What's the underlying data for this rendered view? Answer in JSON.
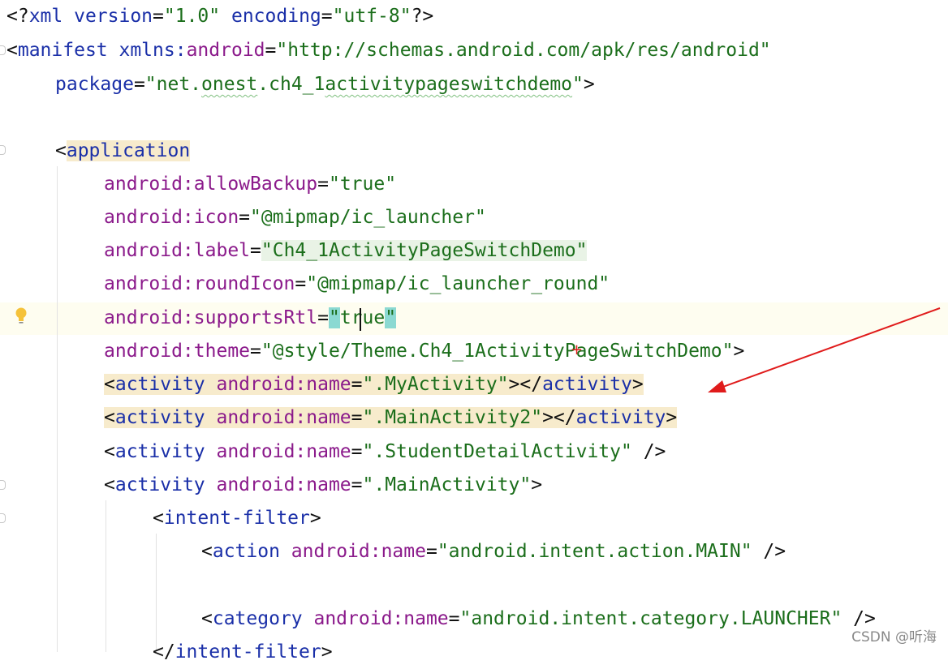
{
  "editor": {
    "lines": [
      [
        {
          "t": "<?",
          "c": "t-punct"
        },
        {
          "t": "xml",
          "c": "t-tag"
        },
        {
          "t": " version",
          "c": "t-hdrattr"
        },
        {
          "t": "=",
          "c": "t-punct"
        },
        {
          "t": "\"1.0\"",
          "c": "t-val"
        },
        {
          "t": " encoding",
          "c": "t-hdrattr"
        },
        {
          "t": "=",
          "c": "t-punct"
        },
        {
          "t": "\"utf-8\"",
          "c": "t-val"
        },
        {
          "t": "?>",
          "c": "t-punct"
        }
      ],
      [
        {
          "t": "<",
          "c": "t-punct"
        },
        {
          "t": "manifest",
          "c": "t-tag"
        },
        {
          "t": " xmlns:",
          "c": "t-hdrattr"
        },
        {
          "t": "android",
          "c": "t-ns"
        },
        {
          "t": "=",
          "c": "t-punct"
        },
        {
          "t": "\"http://schemas.android.com/apk/res/android\"",
          "c": "t-val"
        }
      ],
      [
        {
          "t": "package",
          "c": "t-hdrattr"
        },
        {
          "t": "=",
          "c": "t-punct"
        },
        {
          "t": "\"net.",
          "c": "t-val"
        },
        {
          "t": "onest",
          "c": "t-val squiggle"
        },
        {
          "t": ".ch4_1",
          "c": "t-val"
        },
        {
          "t": "activitypageswitchdemo",
          "c": "t-val squiggle"
        },
        {
          "t": "\"",
          "c": "t-val"
        },
        {
          "t": ">",
          "c": "t-punct"
        }
      ],
      [],
      [
        {
          "t": "<",
          "c": "t-punct"
        },
        {
          "t": "application",
          "c": "t-tag hl-tag"
        }
      ],
      [
        {
          "t": "android:",
          "c": "t-ns"
        },
        {
          "t": "allowBackup",
          "c": "t-attr"
        },
        {
          "t": "=",
          "c": "t-punct"
        },
        {
          "t": "\"true\"",
          "c": "t-val"
        }
      ],
      [
        {
          "t": "android:",
          "c": "t-ns"
        },
        {
          "t": "icon",
          "c": "t-attr"
        },
        {
          "t": "=",
          "c": "t-punct"
        },
        {
          "t": "\"@mipmap/ic_launcher\"",
          "c": "t-val"
        }
      ],
      [
        {
          "t": "android:",
          "c": "t-ns"
        },
        {
          "t": "label",
          "c": "t-attr"
        },
        {
          "t": "=",
          "c": "t-punct"
        },
        {
          "t": "\"Ch4_1ActivityPageSwitchDemo\"",
          "c": "t-val hl-val"
        }
      ],
      [
        {
          "t": "android:",
          "c": "t-ns"
        },
        {
          "t": "roundIcon",
          "c": "t-attr"
        },
        {
          "t": "=",
          "c": "t-punct"
        },
        {
          "t": "\"@mipmap/ic_launcher_round\"",
          "c": "t-val"
        }
      ],
      [
        {
          "t": "android:",
          "c": "t-ns"
        },
        {
          "t": "supportsRtl",
          "c": "t-attr"
        },
        {
          "t": "=",
          "c": "t-punct"
        },
        {
          "t": "\"",
          "c": "t-val hl-quote"
        },
        {
          "t": "true",
          "c": "t-val"
        },
        {
          "t": "\"",
          "c": "t-val hl-quote"
        }
      ],
      [
        {
          "t": "android:",
          "c": "t-ns"
        },
        {
          "t": "theme",
          "c": "t-attr"
        },
        {
          "t": "=",
          "c": "t-punct"
        },
        {
          "t": "\"@style/Theme.Ch4_1ActivityPageSwitchDemo\"",
          "c": "t-val"
        },
        {
          "t": ">",
          "c": "t-punct"
        }
      ],
      [
        {
          "t": "<",
          "c": "t-punct hl-tag"
        },
        {
          "t": "activity",
          "c": "t-tag hl-tag"
        },
        {
          "t": " android:",
          "c": "t-ns hl-tag"
        },
        {
          "t": "name",
          "c": "t-attr hl-tag"
        },
        {
          "t": "=",
          "c": "t-punct hl-tag"
        },
        {
          "t": "\".MyActivity\"",
          "c": "t-val hl-tag"
        },
        {
          "t": "></",
          "c": "t-punct hl-tag"
        },
        {
          "t": "activity",
          "c": "t-tag hl-tag"
        },
        {
          "t": ">",
          "c": "t-punct hl-tag"
        }
      ],
      [
        {
          "t": "<",
          "c": "t-punct hl-tag"
        },
        {
          "t": "activity",
          "c": "t-tag hl-tag"
        },
        {
          "t": " android:",
          "c": "t-ns hl-tag"
        },
        {
          "t": "name",
          "c": "t-attr hl-tag"
        },
        {
          "t": "=",
          "c": "t-punct hl-tag"
        },
        {
          "t": "\".MainActivity2\"",
          "c": "t-val hl-tag"
        },
        {
          "t": "></",
          "c": "t-punct hl-tag"
        },
        {
          "t": "activity",
          "c": "t-tag hl-tag"
        },
        {
          "t": ">",
          "c": "t-punct hl-tag"
        }
      ],
      [
        {
          "t": "<",
          "c": "t-punct"
        },
        {
          "t": "activity",
          "c": "t-tag"
        },
        {
          "t": " android:",
          "c": "t-ns"
        },
        {
          "t": "name",
          "c": "t-attr"
        },
        {
          "t": "=",
          "c": "t-punct"
        },
        {
          "t": "\".StudentDetailActivity\"",
          "c": "t-val"
        },
        {
          "t": " />",
          "c": "t-punct"
        }
      ],
      [
        {
          "t": "<",
          "c": "t-punct"
        },
        {
          "t": "activity",
          "c": "t-tag"
        },
        {
          "t": " android:",
          "c": "t-ns"
        },
        {
          "t": "name",
          "c": "t-attr"
        },
        {
          "t": "=",
          "c": "t-punct"
        },
        {
          "t": "\".MainActivity\"",
          "c": "t-val"
        },
        {
          "t": ">",
          "c": "t-punct"
        }
      ],
      [
        {
          "t": "<",
          "c": "t-punct"
        },
        {
          "t": "intent-filter",
          "c": "t-tag"
        },
        {
          "t": ">",
          "c": "t-punct"
        }
      ],
      [
        {
          "t": "<",
          "c": "t-punct"
        },
        {
          "t": "action",
          "c": "t-tag"
        },
        {
          "t": " android:",
          "c": "t-ns"
        },
        {
          "t": "name",
          "c": "t-attr"
        },
        {
          "t": "=",
          "c": "t-punct"
        },
        {
          "t": "\"android.intent.action.MAIN\"",
          "c": "t-val"
        },
        {
          "t": " />",
          "c": "t-punct"
        }
      ],
      [],
      [
        {
          "t": "<",
          "c": "t-punct"
        },
        {
          "t": "category",
          "c": "t-tag"
        },
        {
          "t": " android:",
          "c": "t-ns"
        },
        {
          "t": "name",
          "c": "t-attr"
        },
        {
          "t": "=",
          "c": "t-punct"
        },
        {
          "t": "\"android.intent.category.LAUNCHER\"",
          "c": "t-val"
        },
        {
          "t": " />",
          "c": "t-punct"
        }
      ],
      [
        {
          "t": "</",
          "c": "t-punct"
        },
        {
          "t": "intent-filter",
          "c": "t-tag"
        },
        {
          "t": ">",
          "c": "t-punct"
        }
      ]
    ]
  },
  "watermark": "CSDN @听海",
  "icons": {
    "bulb": "lightbulb-icon",
    "arrow": "red-arrow-annotation"
  },
  "colors": {
    "tag": "#1a2fa8",
    "attr": "#8b1a8b",
    "value": "#1b6e1b",
    "annotation": "#e01b1b"
  }
}
